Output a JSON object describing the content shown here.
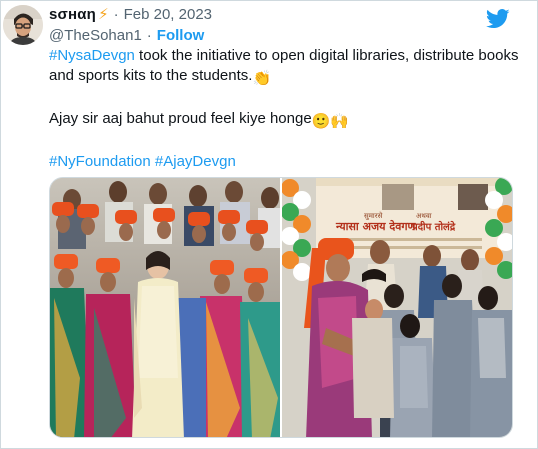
{
  "tweet": {
    "display_name": "sσнαη",
    "name_emoji": "⚡",
    "separator": "·",
    "date": "Feb 20, 2023",
    "handle": "@TheSohan1",
    "follow_separator": "·",
    "follow_label": "Follow"
  },
  "body": {
    "line1_hashtag": "#NysaDevgn",
    "line1_text": " took the initiative to open digital libraries, distribute books and sports kits to the students.",
    "line1_emoji": "👏",
    "line2_text": "Ajay sir aaj bahut proud feel kiye honge",
    "line2_emoji": "🙂🙌",
    "hashtag1": "#NyFoundation",
    "hashtag2": "#AjayDevgn"
  },
  "photo_banner": {
    "line1": "सुमारसे",
    "line2": "न्यासा अजय देवगण",
    "line3": "अथवा",
    "line4": "प्रदीप तोलंद्रे"
  },
  "icons": {
    "brand": "twitter-bird-icon",
    "name_badge": "lightning-bolt-icon"
  },
  "colors": {
    "link": "#1d9bf0",
    "secondary_text": "#536471",
    "primary_text": "#0f1419",
    "border": "#cfd9de"
  }
}
